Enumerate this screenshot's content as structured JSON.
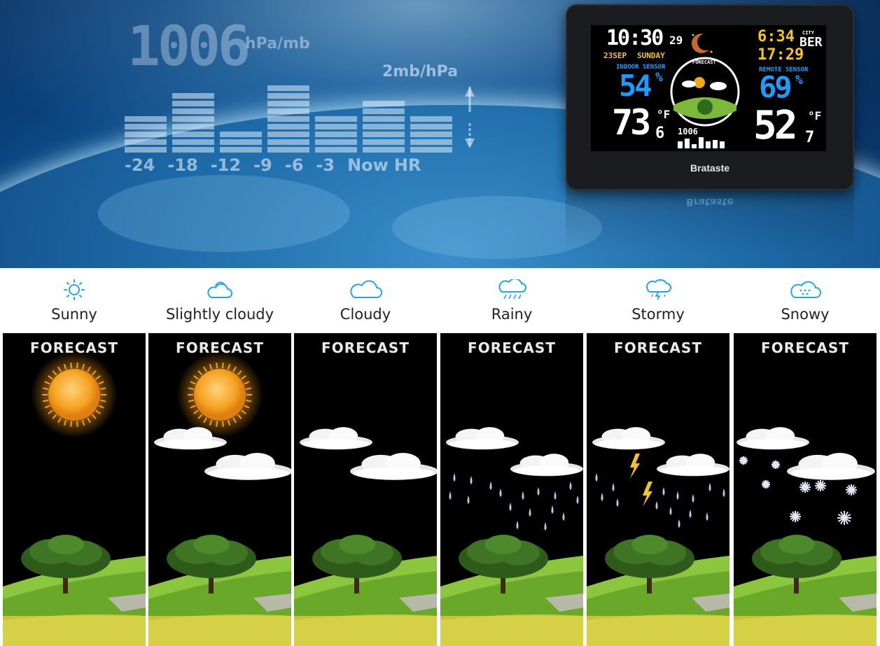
{
  "hero": {
    "pressure_value": "1006",
    "pressure_unit": "hPa/mb",
    "scale_label": "2mb/hPa",
    "history_labels": [
      "-24",
      "-18",
      "-12",
      "-9",
      "-6",
      "-3",
      "Now",
      "HR"
    ],
    "history_levels": [
      5,
      8,
      3,
      9,
      5,
      7,
      5
    ]
  },
  "device": {
    "brand": "Brataste",
    "time": "10:30",
    "seconds": "29",
    "date": "23SEP",
    "weekday": "SUNDAY",
    "sunrise": "6:34",
    "sunset": "17:29",
    "city_label": "CITY",
    "city": "BER",
    "indoor_label": "INDOOR SENSOR",
    "indoor_humidity": "54",
    "indoor_temp": "73",
    "indoor_temp_decimal": "6",
    "remote_label": "REMOTE SENSOR",
    "remote_humidity": "69",
    "remote_temp": "52",
    "remote_temp_decimal": "7",
    "forecast_label": "FORECAST",
    "mini_pressure": "1006",
    "unit_percent": "%",
    "unit_f": "°F"
  },
  "forecast_panels": [
    {
      "name": "Sunny",
      "title": "FORECAST"
    },
    {
      "name": "Slightly cloudy",
      "title": "FORECAST"
    },
    {
      "name": "Cloudy",
      "title": "FORECAST"
    },
    {
      "name": "Rainy",
      "title": "FORECAST"
    },
    {
      "name": "Stormy",
      "title": "FORECAST"
    },
    {
      "name": "Snowy",
      "title": "FORECAST"
    }
  ],
  "colors": {
    "icon_blue": "#29a4e6",
    "device_cyan": "#1e9bff",
    "device_yellow": "#f5c518",
    "device_white": "#ffffff"
  }
}
